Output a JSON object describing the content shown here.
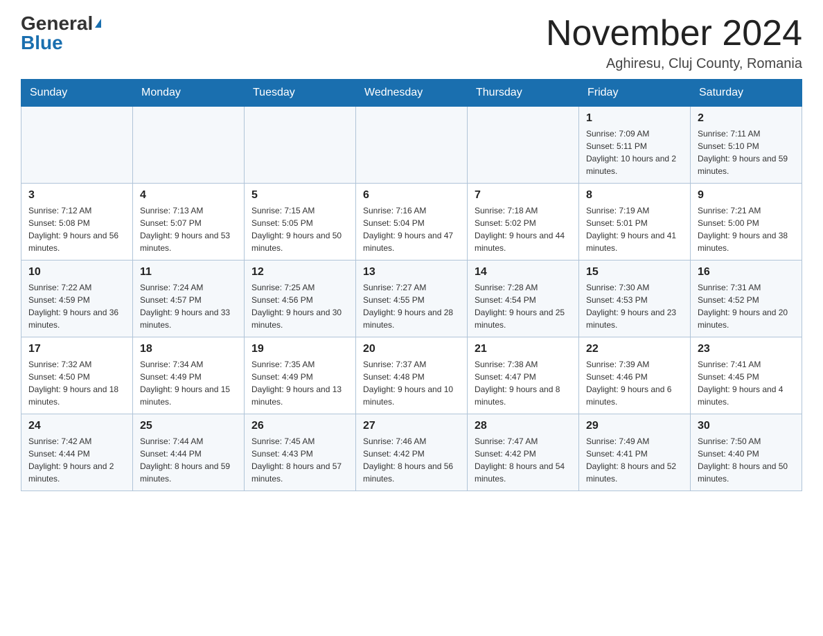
{
  "logo": {
    "general": "General",
    "blue": "Blue",
    "triangle": "▲"
  },
  "title": "November 2024",
  "location": "Aghiresu, Cluj County, Romania",
  "days_of_week": [
    "Sunday",
    "Monday",
    "Tuesday",
    "Wednesday",
    "Thursday",
    "Friday",
    "Saturday"
  ],
  "weeks": [
    [
      {
        "day": "",
        "info": ""
      },
      {
        "day": "",
        "info": ""
      },
      {
        "day": "",
        "info": ""
      },
      {
        "day": "",
        "info": ""
      },
      {
        "day": "",
        "info": ""
      },
      {
        "day": "1",
        "info": "Sunrise: 7:09 AM\nSunset: 5:11 PM\nDaylight: 10 hours and 2 minutes."
      },
      {
        "day": "2",
        "info": "Sunrise: 7:11 AM\nSunset: 5:10 PM\nDaylight: 9 hours and 59 minutes."
      }
    ],
    [
      {
        "day": "3",
        "info": "Sunrise: 7:12 AM\nSunset: 5:08 PM\nDaylight: 9 hours and 56 minutes."
      },
      {
        "day": "4",
        "info": "Sunrise: 7:13 AM\nSunset: 5:07 PM\nDaylight: 9 hours and 53 minutes."
      },
      {
        "day": "5",
        "info": "Sunrise: 7:15 AM\nSunset: 5:05 PM\nDaylight: 9 hours and 50 minutes."
      },
      {
        "day": "6",
        "info": "Sunrise: 7:16 AM\nSunset: 5:04 PM\nDaylight: 9 hours and 47 minutes."
      },
      {
        "day": "7",
        "info": "Sunrise: 7:18 AM\nSunset: 5:02 PM\nDaylight: 9 hours and 44 minutes."
      },
      {
        "day": "8",
        "info": "Sunrise: 7:19 AM\nSunset: 5:01 PM\nDaylight: 9 hours and 41 minutes."
      },
      {
        "day": "9",
        "info": "Sunrise: 7:21 AM\nSunset: 5:00 PM\nDaylight: 9 hours and 38 minutes."
      }
    ],
    [
      {
        "day": "10",
        "info": "Sunrise: 7:22 AM\nSunset: 4:59 PM\nDaylight: 9 hours and 36 minutes."
      },
      {
        "day": "11",
        "info": "Sunrise: 7:24 AM\nSunset: 4:57 PM\nDaylight: 9 hours and 33 minutes."
      },
      {
        "day": "12",
        "info": "Sunrise: 7:25 AM\nSunset: 4:56 PM\nDaylight: 9 hours and 30 minutes."
      },
      {
        "day": "13",
        "info": "Sunrise: 7:27 AM\nSunset: 4:55 PM\nDaylight: 9 hours and 28 minutes."
      },
      {
        "day": "14",
        "info": "Sunrise: 7:28 AM\nSunset: 4:54 PM\nDaylight: 9 hours and 25 minutes."
      },
      {
        "day": "15",
        "info": "Sunrise: 7:30 AM\nSunset: 4:53 PM\nDaylight: 9 hours and 23 minutes."
      },
      {
        "day": "16",
        "info": "Sunrise: 7:31 AM\nSunset: 4:52 PM\nDaylight: 9 hours and 20 minutes."
      }
    ],
    [
      {
        "day": "17",
        "info": "Sunrise: 7:32 AM\nSunset: 4:50 PM\nDaylight: 9 hours and 18 minutes."
      },
      {
        "day": "18",
        "info": "Sunrise: 7:34 AM\nSunset: 4:49 PM\nDaylight: 9 hours and 15 minutes."
      },
      {
        "day": "19",
        "info": "Sunrise: 7:35 AM\nSunset: 4:49 PM\nDaylight: 9 hours and 13 minutes."
      },
      {
        "day": "20",
        "info": "Sunrise: 7:37 AM\nSunset: 4:48 PM\nDaylight: 9 hours and 10 minutes."
      },
      {
        "day": "21",
        "info": "Sunrise: 7:38 AM\nSunset: 4:47 PM\nDaylight: 9 hours and 8 minutes."
      },
      {
        "day": "22",
        "info": "Sunrise: 7:39 AM\nSunset: 4:46 PM\nDaylight: 9 hours and 6 minutes."
      },
      {
        "day": "23",
        "info": "Sunrise: 7:41 AM\nSunset: 4:45 PM\nDaylight: 9 hours and 4 minutes."
      }
    ],
    [
      {
        "day": "24",
        "info": "Sunrise: 7:42 AM\nSunset: 4:44 PM\nDaylight: 9 hours and 2 minutes."
      },
      {
        "day": "25",
        "info": "Sunrise: 7:44 AM\nSunset: 4:44 PM\nDaylight: 8 hours and 59 minutes."
      },
      {
        "day": "26",
        "info": "Sunrise: 7:45 AM\nSunset: 4:43 PM\nDaylight: 8 hours and 57 minutes."
      },
      {
        "day": "27",
        "info": "Sunrise: 7:46 AM\nSunset: 4:42 PM\nDaylight: 8 hours and 56 minutes."
      },
      {
        "day": "28",
        "info": "Sunrise: 7:47 AM\nSunset: 4:42 PM\nDaylight: 8 hours and 54 minutes."
      },
      {
        "day": "29",
        "info": "Sunrise: 7:49 AM\nSunset: 4:41 PM\nDaylight: 8 hours and 52 minutes."
      },
      {
        "day": "30",
        "info": "Sunrise: 7:50 AM\nSunset: 4:40 PM\nDaylight: 8 hours and 50 minutes."
      }
    ]
  ]
}
